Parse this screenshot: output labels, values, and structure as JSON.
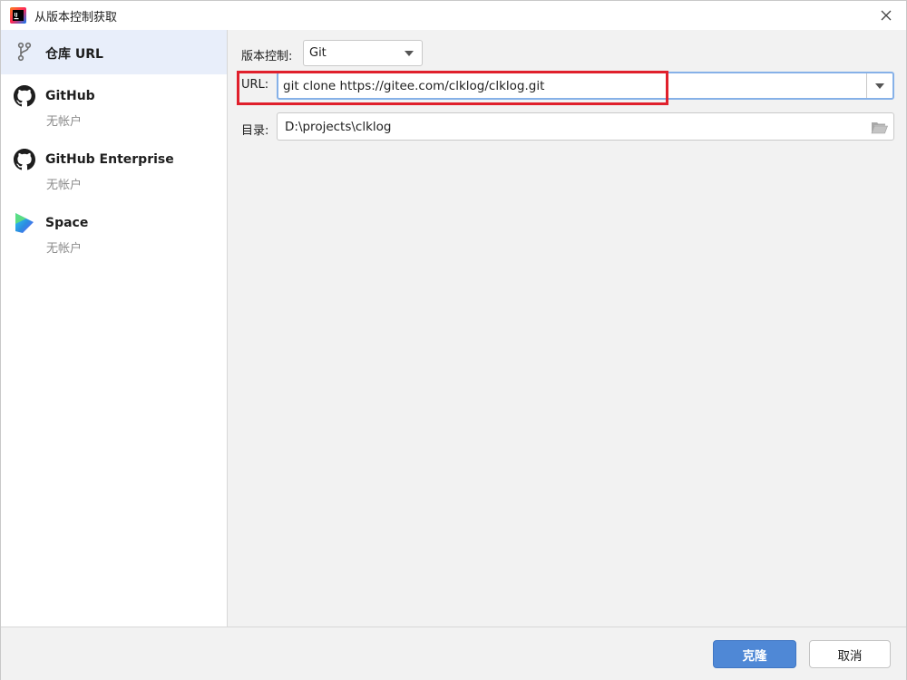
{
  "window": {
    "title": "从版本控制获取",
    "app_icon": "intellij-idea-icon",
    "close_icon": "close-icon"
  },
  "sidebar": {
    "items": [
      {
        "label": "仓库 URL",
        "sub": "",
        "icon": "vcs-branch-icon",
        "selected": true
      },
      {
        "label": "GitHub",
        "sub": "无帐户",
        "icon": "github-icon",
        "selected": false
      },
      {
        "label": "GitHub Enterprise",
        "sub": "无帐户",
        "icon": "github-icon",
        "selected": false
      },
      {
        "label": "Space",
        "sub": "无帐户",
        "icon": "space-icon",
        "selected": false
      }
    ]
  },
  "form": {
    "vcs_label": "版本控制:",
    "vcs_value": "Git",
    "url_label": "URL:",
    "url_value": "git clone https://gitee.com/clklog/clklog.git",
    "dir_label": "目录:",
    "dir_value": "D:\\projects\\clklog"
  },
  "footer": {
    "clone_label": "克隆",
    "cancel_label": "取消"
  },
  "colors": {
    "accent": "#4f88d6",
    "highlight": "#e0202c",
    "focus_border": "#86b1e8",
    "selected_bg": "#e8eefa"
  }
}
